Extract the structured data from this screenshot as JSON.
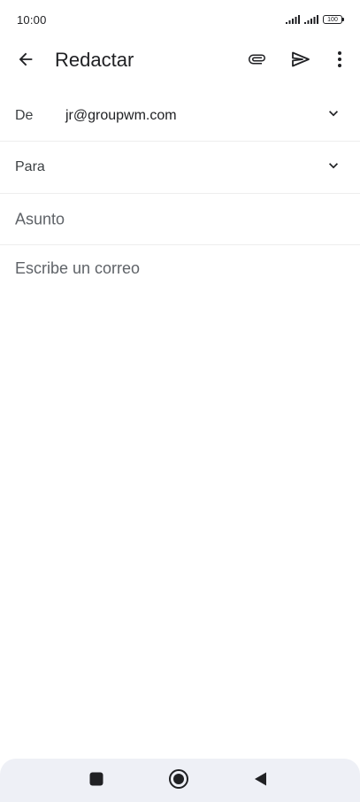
{
  "status_bar": {
    "time": "10:00",
    "battery": "100"
  },
  "app_bar": {
    "title": "Redactar",
    "icons": {
      "back": "back-arrow-icon",
      "attach": "paperclip-icon",
      "send": "send-icon",
      "more": "more-vert-icon"
    }
  },
  "fields": {
    "from": {
      "label": "De",
      "value": "jr@groupwm.com"
    },
    "to": {
      "label": "Para"
    },
    "subject": {
      "placeholder": "Asunto"
    },
    "body": {
      "placeholder": "Escribe un correo"
    }
  },
  "colors": {
    "text": "#202124",
    "secondary_text": "#5f6368",
    "divider": "#eeeeee",
    "nav_bar_bg": "#eef0f6"
  },
  "nav_bar": {
    "icons": [
      "square-recents-icon",
      "circle-home-icon",
      "triangle-back-icon"
    ]
  }
}
